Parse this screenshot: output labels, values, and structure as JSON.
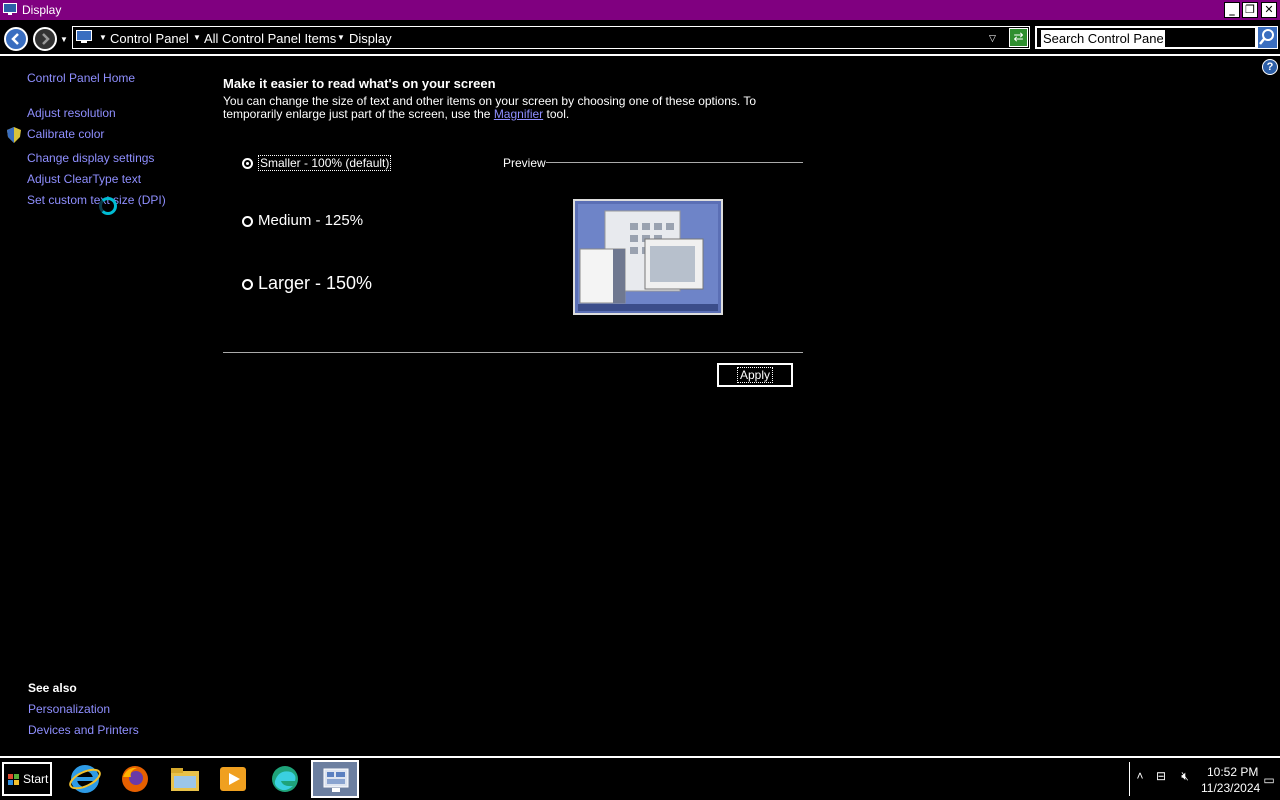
{
  "window": {
    "title": "Display"
  },
  "address": {
    "crumbs": [
      "Control Panel",
      "All Control Panel Items",
      "Display"
    ],
    "search_placeholder": "Search Control Panel"
  },
  "sidebar": {
    "home": "Control Panel Home",
    "links": [
      "Adjust resolution",
      "Calibrate color",
      "Change display settings",
      "Adjust ClearType text",
      "Set custom text size (DPI)"
    ],
    "see_also_title": "See also",
    "see_also": [
      "Personalization",
      "Devices and Printers"
    ]
  },
  "main": {
    "heading": "Make it easier to read what's on your screen",
    "desc_before": "You can change the size of text and other items on your screen by choosing one of these options. To temporarily enlarge just part of the screen, use the ",
    "desc_link": "Magnifier",
    "desc_after": " tool.",
    "options": [
      {
        "label": "Smaller - 100% (default)",
        "selected": true
      },
      {
        "label": "Medium - 125%",
        "selected": false
      },
      {
        "label": "Larger - 150%",
        "selected": false
      }
    ],
    "preview_label": "Preview",
    "apply_label": "Apply"
  },
  "taskbar": {
    "start_label": "Start",
    "apps": [
      "internet-explorer-icon",
      "firefox-icon",
      "file-explorer-icon",
      "media-player-icon",
      "edge-icon",
      "control-panel-icon"
    ],
    "time": "10:52 PM",
    "date": "11/23/2024"
  },
  "colors": {
    "titlebar": "#800080",
    "link": "#8f8fff",
    "background": "#000000"
  }
}
